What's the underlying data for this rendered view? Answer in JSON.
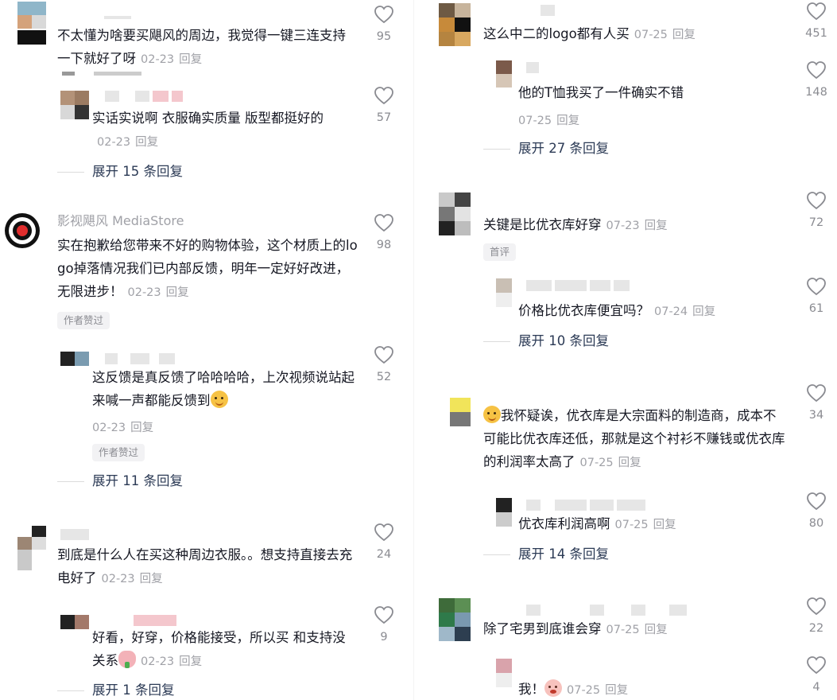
{
  "ui": {
    "reply_label": "回复",
    "liked_by_author_badge": "作者赞过",
    "first_comment_badge": "首评"
  },
  "left": {
    "c1": {
      "text": "不太懂为啥要买飓风的周边，我觉得一键三连支持一下就好了呀",
      "date": "02-23",
      "likes": "95",
      "r1": {
        "text": "实话实说啊 衣服确实质量 版型都挺好的",
        "date": "02-23",
        "likes": "57"
      },
      "expand": "展开 15 条回复"
    },
    "c2": {
      "user": "影视飓风 MediaStore",
      "text": "实在抱歉给您带来不好的购物体验，这个材质上的logo掉落情况我们已内部反馈，明年一定好好改进，无限进步！",
      "date": "02-23",
      "likes": "98",
      "r1": {
        "text": "这反馈是真反馈了哈哈哈哈，上次视频说站起来喊一声都能反馈到",
        "date": "02-23",
        "likes": "52"
      },
      "expand": "展开 11 条回复"
    },
    "c3": {
      "text": "到底是什么人在买这种周边衣服。。想支持直接去充电好了",
      "date": "02-23",
      "likes": "24",
      "r1": {
        "text": "好看，好穿，价格能接受，所以买 和支持没关系",
        "date": "02-23",
        "likes": "9"
      },
      "expand": "展开 1 条回复"
    }
  },
  "right": {
    "c1": {
      "text": "这么中二的logo都有人买",
      "date": "07-25",
      "likes": "451",
      "r1": {
        "text": "他的T恤我买了一件确实不错",
        "date": "07-25",
        "likes": "148"
      },
      "expand": "展开 27 条回复"
    },
    "c2": {
      "text": "关键是比优衣库好穿",
      "date": "07-23",
      "likes": "72",
      "r1": {
        "text": "价格比优衣库便宜吗？",
        "date": "07-24",
        "likes": "61"
      },
      "expand": "展开 10 条回复"
    },
    "c3": {
      "text": "我怀疑诶，优衣库是大宗面料的制造商，成本不可能比优衣库还低，那就是这个衬衫不赚钱或优衣库的利润率太高了",
      "date": "07-25",
      "likes": "34",
      "r1": {
        "text": "优衣库利润高啊",
        "date": "07-25",
        "likes": "80"
      },
      "expand": "展开 14 条回复"
    },
    "c4": {
      "text": "除了宅男到底谁会穿",
      "date": "07-25",
      "likes": "22",
      "r1": {
        "text": "我！",
        "date": "07-25",
        "likes": "4"
      }
    }
  },
  "colors": {
    "accent_link": "#2b3a55",
    "meta_gray": "#a0a1a7",
    "logo_red": "#e02d2d"
  }
}
